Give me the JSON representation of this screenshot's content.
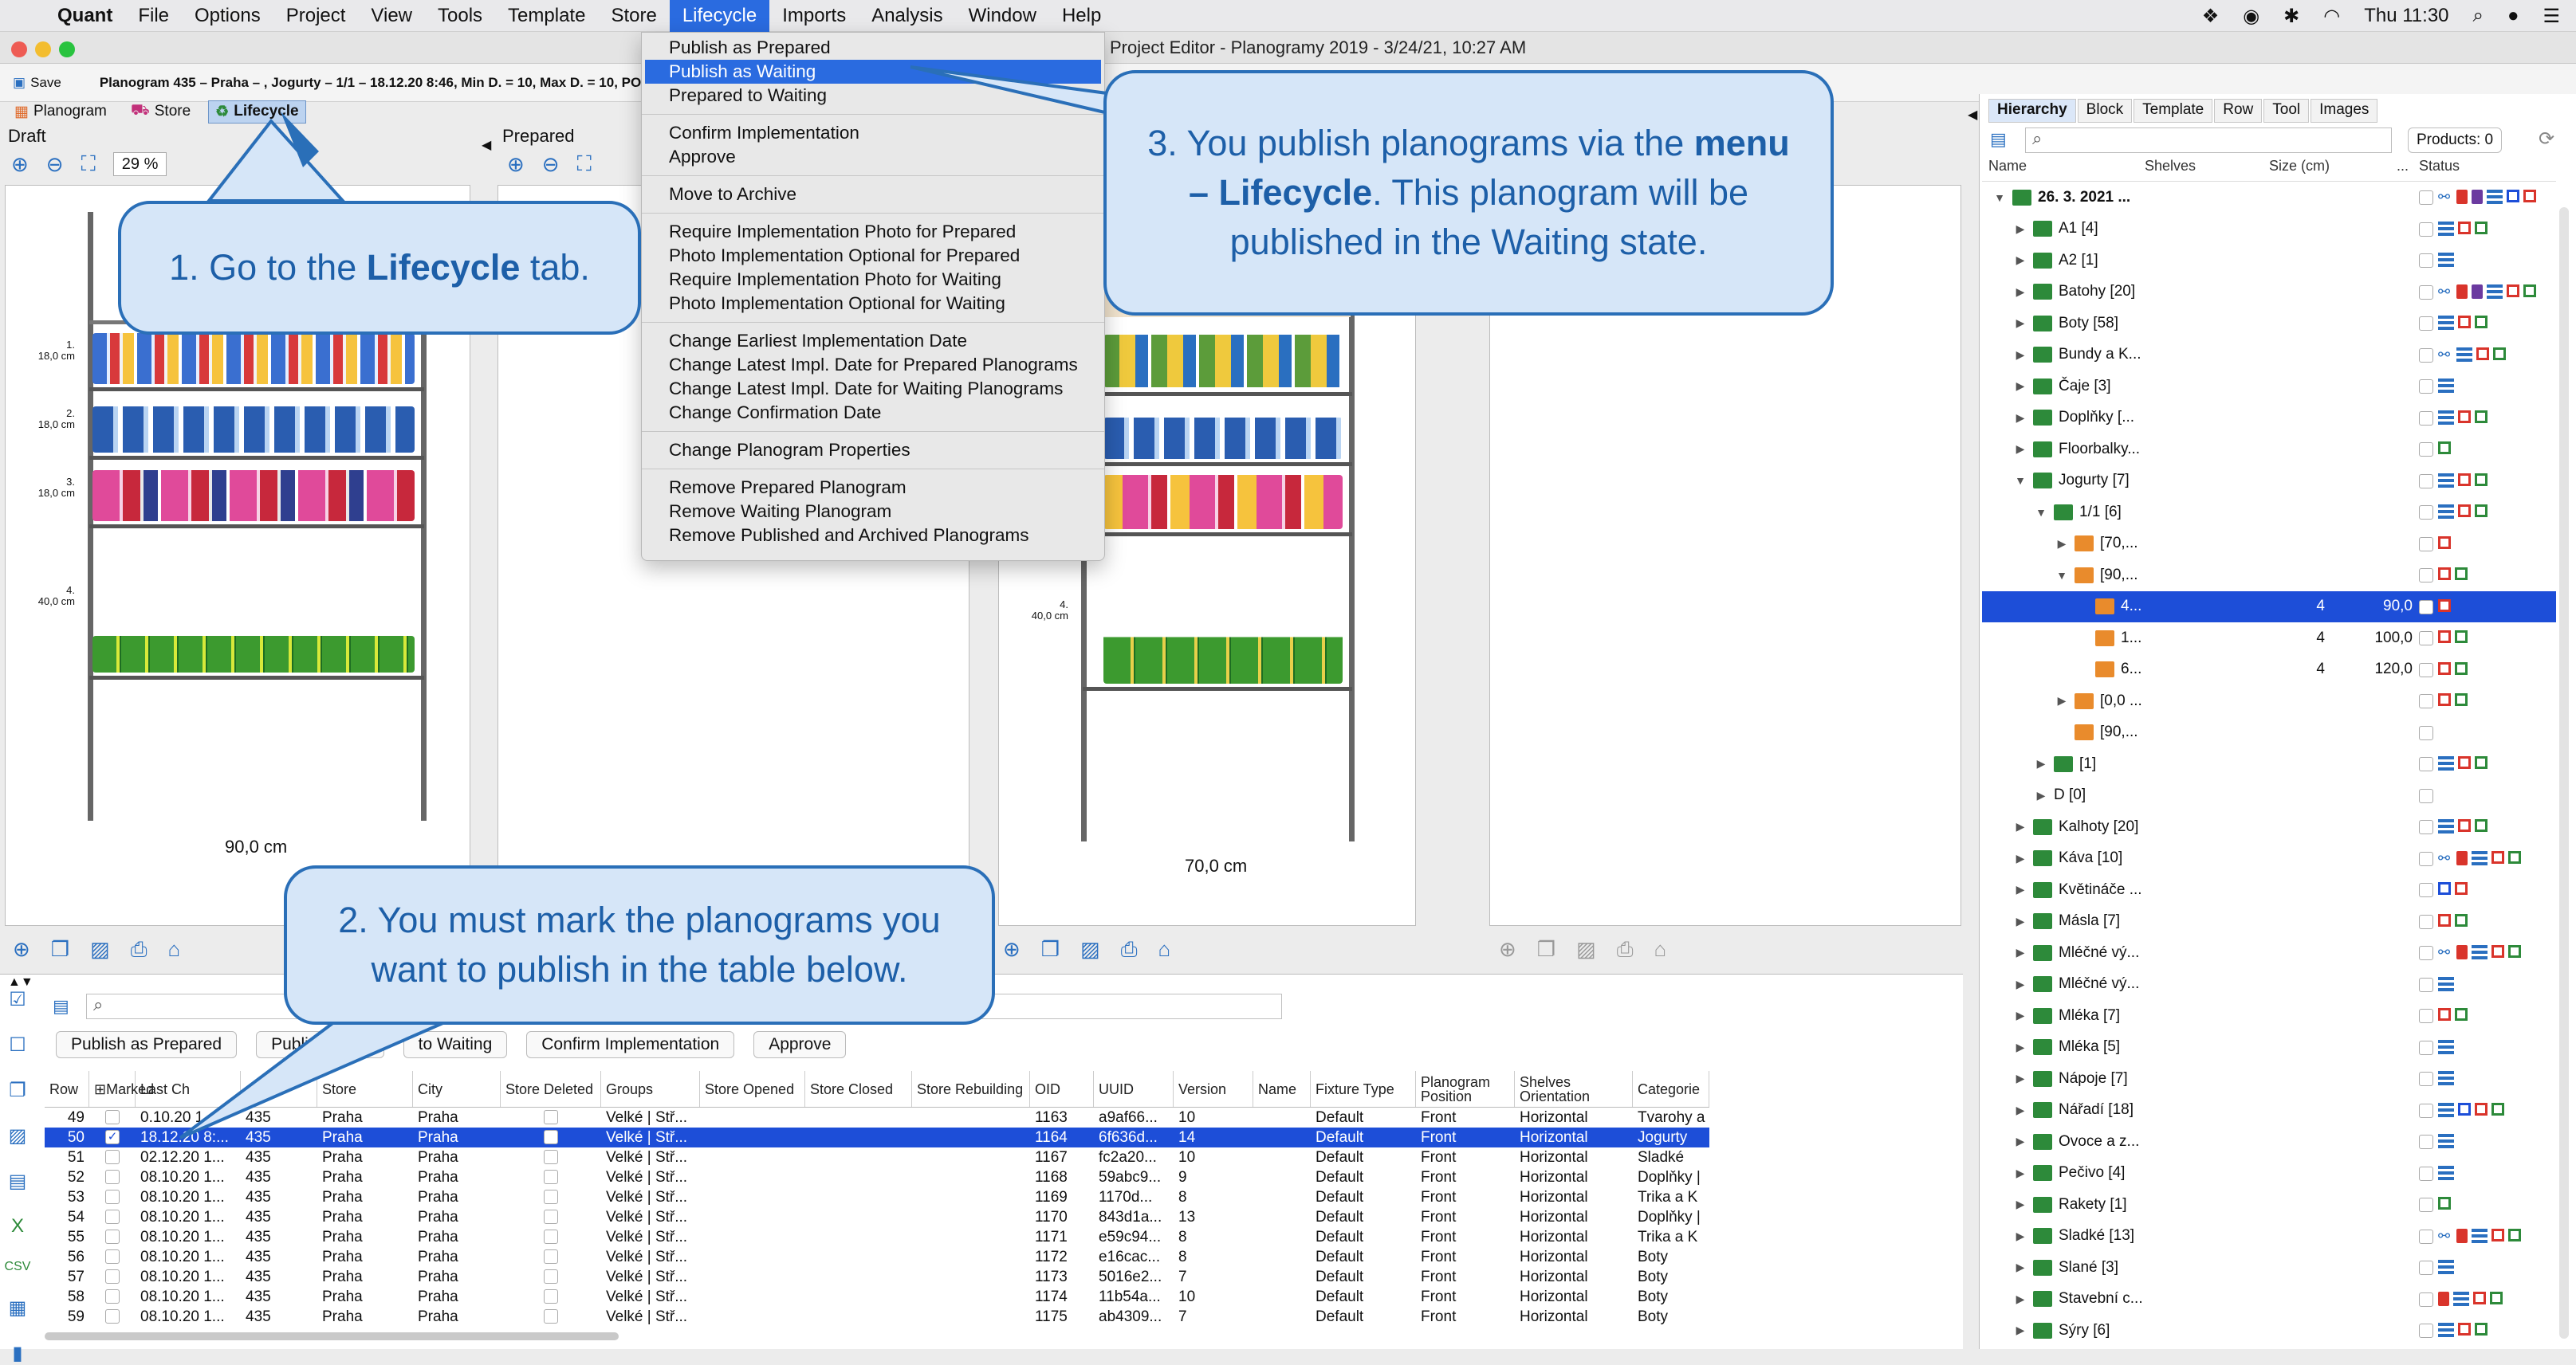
{
  "menubar": {
    "app": "Quant",
    "items": [
      "File",
      "Options",
      "Project",
      "View",
      "Tools",
      "Template",
      "Store",
      "Lifecycle",
      "Imports",
      "Analysis",
      "Window",
      "Help"
    ],
    "clock": "Thu 11:30"
  },
  "window": {
    "title": "Project Editor - Planogramy 2019 - 3/24/21, 10:27 AM",
    "save_label": "Save",
    "planogram_info": "Planogram 435 – Praha – , Jogurty – 1/1 – 18.12.20 8:46, Min D. = 10, Max D. = 10, POP"
  },
  "view_tabs": [
    "Planogram",
    "Store",
    "Lifecycle"
  ],
  "panels": {
    "draft": {
      "title": "Draft",
      "zoom": "29 %",
      "width_label": "90,0 cm",
      "shelf_labels": [
        {
          "n": "1.",
          "h": "18,0 cm"
        },
        {
          "n": "2.",
          "h": "18,0 cm"
        },
        {
          "n": "3.",
          "h": "18,0 cm"
        },
        {
          "n": "4.",
          "h": "40,0 cm"
        }
      ]
    },
    "prepared": {
      "title": "Prepared"
    },
    "waiting": {
      "width_label": "70,0 cm",
      "shelf_labels": [
        {
          "n": "4.",
          "h": "40,0 cm"
        }
      ]
    }
  },
  "lifecycle_menu": {
    "groups": [
      [
        "Publish as Prepared",
        "Publish as Waiting",
        "Prepared to Waiting"
      ],
      [
        "Confirm Implementation",
        "Approve"
      ],
      [
        "Move to Archive"
      ],
      [
        "Require Implementation Photo for Prepared",
        "Photo Implementation Optional for Prepared",
        "Require Implementation Photo for Waiting",
        "Photo Implementation Optional for Waiting"
      ],
      [
        "Change Earliest Implementation Date",
        "Change Latest Impl. Date for Prepared Planograms",
        "Change Latest Impl. Date for Waiting Planograms",
        "Change Confirmation Date"
      ],
      [
        "Change Planogram Properties"
      ],
      [
        "Remove Prepared Planogram",
        "Remove Waiting Planogram",
        "Remove Published and Archived Planograms"
      ]
    ],
    "highlighted": "Publish as Waiting"
  },
  "callouts": {
    "one_pre": "1. Go to the ",
    "one_bold": "Lifecycle",
    "one_post": " tab.",
    "two": "2. You must mark the planograms you want to publish in the table below.",
    "three_pre": "3. You publish planograms via the ",
    "three_bold": "menu – Lifecycle",
    "three_post": ". This planogram will be published in the Waiting state."
  },
  "right_panel": {
    "tabs": [
      "Hierarchy",
      "Block",
      "Template",
      "Row",
      "Tool",
      "Images"
    ],
    "products_label": "Products: 0",
    "columns": [
      "Name",
      "Shelves",
      "Size (cm)",
      "...",
      "Status"
    ],
    "tree": [
      {
        "indent": 0,
        "arrow": "▼",
        "icon": "list",
        "label": "26. 3. 2021 ...",
        "bold": true,
        "status": [
          "link",
          "red-doc",
          "purple-doc",
          "grid",
          "blue",
          "red"
        ]
      },
      {
        "indent": 1,
        "arrow": "▶",
        "icon": "list",
        "label": "A1 [4]",
        "status": [
          "grid",
          "red",
          "green"
        ]
      },
      {
        "indent": 1,
        "arrow": "▶",
        "icon": "list",
        "label": "A2 [1]",
        "status": [
          "grid"
        ]
      },
      {
        "indent": 1,
        "arrow": "▶",
        "icon": "list",
        "label": "Batohy [20]",
        "status": [
          "link",
          "red-doc",
          "purple-doc",
          "grid",
          "red",
          "green"
        ]
      },
      {
        "indent": 1,
        "arrow": "▶",
        "icon": "list",
        "label": "Boty [58]",
        "status": [
          "grid",
          "red",
          "green"
        ]
      },
      {
        "indent": 1,
        "arrow": "▶",
        "icon": "list",
        "label": "Bundy a K...",
        "status": [
          "link",
          "grid",
          "red",
          "green"
        ]
      },
      {
        "indent": 1,
        "arrow": "▶",
        "icon": "list",
        "label": "Čaje [3]",
        "status": [
          "grid"
        ]
      },
      {
        "indent": 1,
        "arrow": "▶",
        "icon": "list",
        "label": "Doplňky [...",
        "status": [
          "grid",
          "red",
          "green"
        ]
      },
      {
        "indent": 1,
        "arrow": "▶",
        "icon": "list",
        "label": "Floorbalky...",
        "status": [
          "green"
        ]
      },
      {
        "indent": 1,
        "arrow": "▼",
        "icon": "list",
        "label": "Jogurty [7]",
        "status": [
          "grid",
          "red",
          "green"
        ]
      },
      {
        "indent": 2,
        "arrow": "▼",
        "icon": "list",
        "label": "1/1 [6]",
        "status": [
          "grid",
          "red",
          "green"
        ]
      },
      {
        "indent": 3,
        "arrow": "▶",
        "icon": "shelf",
        "label": "[70,...",
        "status": [
          "red"
        ]
      },
      {
        "indent": 3,
        "arrow": "▼",
        "icon": "shelf",
        "label": "[90,...",
        "status": [
          "red",
          "green"
        ]
      },
      {
        "indent": 4,
        "arrow": "",
        "icon": "shelf",
        "label": "4...",
        "shelves": "4",
        "size": "90,0",
        "status": [
          "red"
        ],
        "selected": true
      },
      {
        "indent": 4,
        "arrow": "",
        "icon": "shelf",
        "label": "1...",
        "shelves": "4",
        "size": "100,0",
        "status": [
          "red",
          "green"
        ]
      },
      {
        "indent": 4,
        "arrow": "",
        "icon": "shelf",
        "label": "6...",
        "shelves": "4",
        "size": "120,0",
        "status": [
          "red",
          "green"
        ]
      },
      {
        "indent": 3,
        "arrow": "▶",
        "icon": "shelf",
        "label": "[0,0 ...",
        "status": [
          "red",
          "green"
        ]
      },
      {
        "indent": 3,
        "arrow": "",
        "icon": "shelf",
        "label": "[90,...",
        "status": []
      },
      {
        "indent": 2,
        "arrow": "▶",
        "icon": "list",
        "label": "[1]",
        "status": [
          "grid",
          "red",
          "green"
        ]
      },
      {
        "indent": 2,
        "arrow": "▶",
        "icon": "",
        "label": "D [0]",
        "status": []
      },
      {
        "indent": 1,
        "arrow": "▶",
        "icon": "list",
        "label": "Kalhoty [20]",
        "status": [
          "grid",
          "red",
          "green"
        ]
      },
      {
        "indent": 1,
        "arrow": "▶",
        "icon": "list",
        "label": "Káva [10]",
        "status": [
          "link",
          "red-doc",
          "grid",
          "red",
          "green"
        ]
      },
      {
        "indent": 1,
        "arrow": "▶",
        "icon": "list",
        "label": "Květináče ...",
        "status": [
          "blue",
          "red"
        ]
      },
      {
        "indent": 1,
        "arrow": "▶",
        "icon": "list",
        "label": "Másla [7]",
        "status": [
          "red",
          "green"
        ]
      },
      {
        "indent": 1,
        "arrow": "▶",
        "icon": "list",
        "label": "Mléčné vý...",
        "status": [
          "link",
          "red-doc",
          "grid",
          "red",
          "green"
        ]
      },
      {
        "indent": 1,
        "arrow": "▶",
        "icon": "list",
        "label": "Mléčné vý...",
        "status": [
          "grid"
        ]
      },
      {
        "indent": 1,
        "arrow": "▶",
        "icon": "list",
        "label": "Mléka [7]",
        "status": [
          "red",
          "green"
        ]
      },
      {
        "indent": 1,
        "arrow": "▶",
        "icon": "list",
        "label": "Mléka [5]",
        "status": [
          "grid"
        ]
      },
      {
        "indent": 1,
        "arrow": "▶",
        "icon": "list",
        "label": "Nápoje [7]",
        "status": [
          "grid"
        ]
      },
      {
        "indent": 1,
        "arrow": "▶",
        "icon": "list",
        "label": "Nářadí [18]",
        "status": [
          "grid",
          "blue",
          "red",
          "green"
        ]
      },
      {
        "indent": 1,
        "arrow": "▶",
        "icon": "list",
        "label": "Ovoce a z...",
        "status": [
          "grid"
        ]
      },
      {
        "indent": 1,
        "arrow": "▶",
        "icon": "list",
        "label": "Pečivo [4]",
        "status": [
          "grid"
        ]
      },
      {
        "indent": 1,
        "arrow": "▶",
        "icon": "list",
        "label": "Rakety [1]",
        "status": [
          "green"
        ]
      },
      {
        "indent": 1,
        "arrow": "▶",
        "icon": "list",
        "label": "Sladké [13]",
        "status": [
          "link",
          "red-doc",
          "grid",
          "red",
          "green"
        ]
      },
      {
        "indent": 1,
        "arrow": "▶",
        "icon": "list",
        "label": "Slané [3]",
        "status": [
          "grid"
        ]
      },
      {
        "indent": 1,
        "arrow": "▶",
        "icon": "list",
        "label": "Stavební c...",
        "status": [
          "red-doc",
          "grid",
          "red",
          "green"
        ]
      },
      {
        "indent": 1,
        "arrow": "▶",
        "icon": "list",
        "label": "Sýry [6]",
        "status": [
          "grid",
          "red",
          "green"
        ]
      }
    ]
  },
  "table": {
    "action_buttons": [
      "Publish as Prepared",
      "Publish as W",
      "to Waiting",
      "Confirm Implementation",
      "Approve"
    ],
    "columns": [
      "Row",
      "Marked",
      "Last Ch",
      "re ID",
      "Store",
      "City",
      "Store Deleted",
      "Groups",
      "Store Opened",
      "Store Closed",
      "Store Rebuilding",
      "OID",
      "UUID",
      "Version",
      "Name",
      "Fixture Type",
      "Planogram Position",
      "Shelves Orientation",
      "Categorie"
    ],
    "rows": [
      {
        "row": "49",
        "marked": false,
        "last": "0.10.20 1...",
        "id": "435",
        "store": "Praha",
        "city": "Praha",
        "groups": "Velké | Stř...",
        "oid": "1163",
        "uuid": "a9af66...",
        "ver": "10",
        "fixture": "Default",
        "pos": "Front",
        "orient": "Horizontal",
        "cat": "Tvarohy a"
      },
      {
        "row": "50",
        "marked": true,
        "last": "18.12.20 8:...",
        "id": "435",
        "store": "Praha",
        "city": "Praha",
        "groups": "Velké | Stř...",
        "oid": "1164",
        "uuid": "6f636d...",
        "ver": "14",
        "fixture": "Default",
        "pos": "Front",
        "orient": "Horizontal",
        "cat": "Jogurty",
        "selected": true
      },
      {
        "row": "51",
        "marked": false,
        "last": "02.12.20 1...",
        "id": "435",
        "store": "Praha",
        "city": "Praha",
        "groups": "Velké | Stř...",
        "oid": "1167",
        "uuid": "fc2a20...",
        "ver": "10",
        "fixture": "Default",
        "pos": "Front",
        "orient": "Horizontal",
        "cat": "Sladké"
      },
      {
        "row": "52",
        "marked": false,
        "last": "08.10.20 1...",
        "id": "435",
        "store": "Praha",
        "city": "Praha",
        "groups": "Velké | Stř...",
        "oid": "1168",
        "uuid": "59abc9...",
        "ver": "9",
        "fixture": "Default",
        "pos": "Front",
        "orient": "Horizontal",
        "cat": "Doplňky |"
      },
      {
        "row": "53",
        "marked": false,
        "last": "08.10.20 1...",
        "id": "435",
        "store": "Praha",
        "city": "Praha",
        "groups": "Velké | Stř...",
        "oid": "1169",
        "uuid": "1170d...",
        "ver": "8",
        "fixture": "Default",
        "pos": "Front",
        "orient": "Horizontal",
        "cat": "Trika a K"
      },
      {
        "row": "54",
        "marked": false,
        "last": "08.10.20 1...",
        "id": "435",
        "store": "Praha",
        "city": "Praha",
        "groups": "Velké | Stř...",
        "oid": "1170",
        "uuid": "843d1a...",
        "ver": "13",
        "fixture": "Default",
        "pos": "Front",
        "orient": "Horizontal",
        "cat": "Doplňky |"
      },
      {
        "row": "55",
        "marked": false,
        "last": "08.10.20 1...",
        "id": "435",
        "store": "Praha",
        "city": "Praha",
        "groups": "Velké | Stř...",
        "oid": "1171",
        "uuid": "e59c94...",
        "ver": "8",
        "fixture": "Default",
        "pos": "Front",
        "orient": "Horizontal",
        "cat": "Trika a K"
      },
      {
        "row": "56",
        "marked": false,
        "last": "08.10.20 1...",
        "id": "435",
        "store": "Praha",
        "city": "Praha",
        "groups": "Velké | Stř...",
        "oid": "1172",
        "uuid": "e16cac...",
        "ver": "8",
        "fixture": "Default",
        "pos": "Front",
        "orient": "Horizontal",
        "cat": "Boty"
      },
      {
        "row": "57",
        "marked": false,
        "last": "08.10.20 1...",
        "id": "435",
        "store": "Praha",
        "city": "Praha",
        "groups": "Velké | Stř...",
        "oid": "1173",
        "uuid": "5016e2...",
        "ver": "7",
        "fixture": "Default",
        "pos": "Front",
        "orient": "Horizontal",
        "cat": "Boty"
      },
      {
        "row": "58",
        "marked": false,
        "last": "08.10.20 1...",
        "id": "435",
        "store": "Praha",
        "city": "Praha",
        "groups": "Velké | Stř...",
        "oid": "1174",
        "uuid": "11b54a...",
        "ver": "10",
        "fixture": "Default",
        "pos": "Front",
        "orient": "Horizontal",
        "cat": "Boty"
      },
      {
        "row": "59",
        "marked": false,
        "last": "08.10.20 1...",
        "id": "435",
        "store": "Praha",
        "city": "Praha",
        "groups": "Velké | Stř...",
        "oid": "1175",
        "uuid": "ab4309...",
        "ver": "7",
        "fixture": "Default",
        "pos": "Front",
        "orient": "Horizontal",
        "cat": "Boty"
      }
    ]
  },
  "colors": {
    "accent": "#2a6be0",
    "selection": "#1d4ed8",
    "callout_fill": "#d6e6f8",
    "callout_border": "#2a6fb8",
    "callout_text": "#1d5fa8"
  }
}
